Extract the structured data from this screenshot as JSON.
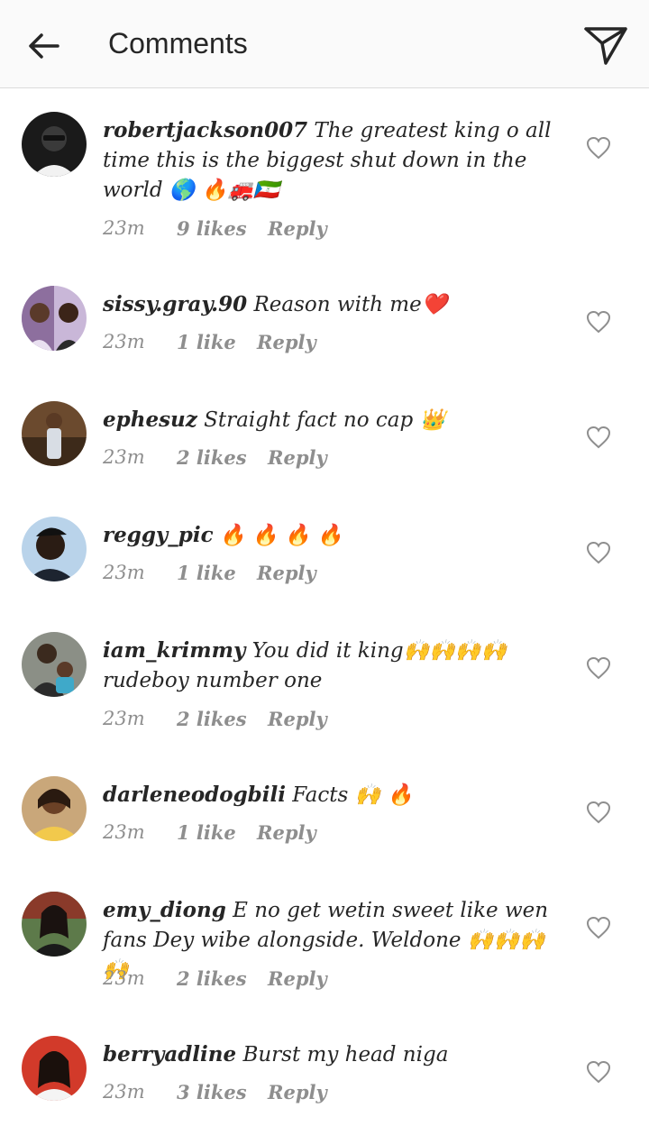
{
  "header": {
    "title": "Comments",
    "back_icon": "arrow-left-icon",
    "send_icon": "paper-plane-icon"
  },
  "comments": [
    {
      "username": "robertjackson007",
      "text": "The greatest king o all time this is the biggest shut down in the world 🌎 🔥🚒🇬🇶",
      "time": "23m",
      "likes": "9 likes",
      "reply": "Reply"
    },
    {
      "username": "sissy.gray.90",
      "text": "Reason with me❤️",
      "time": "23m",
      "likes": "1 like",
      "reply": "Reply"
    },
    {
      "username": "ephesuz",
      "text": "Straight fact no cap 👑",
      "time": "23m",
      "likes": "2 likes",
      "reply": "Reply"
    },
    {
      "username": "reggy_pic",
      "text": "🔥 🔥 🔥 🔥",
      "time": "23m",
      "likes": "1 like",
      "reply": "Reply"
    },
    {
      "username": "iam_krimmy",
      "text": "You did it king🙌🙌🙌🙌 rudeboy number one",
      "time": "23m",
      "likes": "2 likes",
      "reply": "Reply"
    },
    {
      "username": "darleneodogbili",
      "text": "Facts 🙌 🔥",
      "time": "23m",
      "likes": "1 like",
      "reply": "Reply"
    },
    {
      "username": "emy_diong",
      "text": "E no get wetin sweet like wen fans Dey wibe alongside. Weldone 🙌🙌🙌🙌",
      "time": "23m",
      "likes": "2 likes",
      "reply": "Reply"
    },
    {
      "username": "berryadline",
      "text": "Burst my head niga",
      "time": "23m",
      "likes": "3 likes",
      "reply": "Reply"
    }
  ],
  "colors": {
    "text": "#262626",
    "secondary": "#8e8e8e",
    "header_bg": "#fafafa",
    "divider": "#dbdbdb"
  }
}
